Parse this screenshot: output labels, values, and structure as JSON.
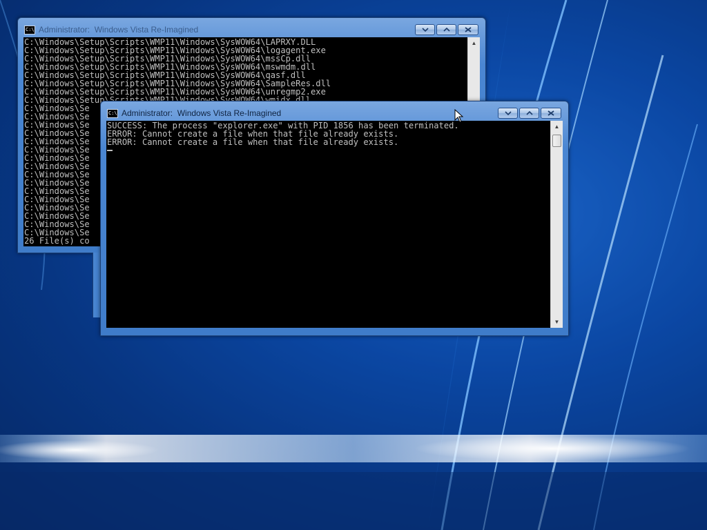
{
  "desktop": {
    "wallpaper": "windows-vista-aurora",
    "colors": {
      "base": "#0b4aa8",
      "glow": "#ffffff"
    }
  },
  "windows": {
    "back": {
      "title_prefix": "Administrator:",
      "title": "Windows Vista Re-Imagined",
      "lines": [
        "C:\\Windows\\Setup\\Scripts\\WMP11\\Windows\\SysWOW64\\LAPRXY.DLL",
        "C:\\Windows\\Setup\\Scripts\\WMP11\\Windows\\SysWOW64\\logagent.exe",
        "C:\\Windows\\Setup\\Scripts\\WMP11\\Windows\\SysWOW64\\mssCp.dll",
        "C:\\Windows\\Setup\\Scripts\\WMP11\\Windows\\SysWOW64\\mswmdm.dll",
        "C:\\Windows\\Setup\\Scripts\\WMP11\\Windows\\SysWOW64\\qasf.dll",
        "C:\\Windows\\Setup\\Scripts\\WMP11\\Windows\\SysWOW64\\SampleRes.dll",
        "C:\\Windows\\Setup\\Scripts\\WMP11\\Windows\\SysWOW64\\unregmp2.exe",
        "C:\\Windows\\Setup\\Scripts\\WMP11\\Windows\\SysWOW64\\wmidx.dll",
        "C:\\Windows\\Se",
        "C:\\Windows\\Se",
        "C:\\Windows\\Se",
        "C:\\Windows\\Se",
        "C:\\Windows\\Se",
        "C:\\Windows\\Se",
        "C:\\Windows\\Se",
        "C:\\Windows\\Se",
        "C:\\Windows\\Se",
        "C:\\Windows\\Se",
        "C:\\Windows\\Se",
        "C:\\Windows\\Se",
        "C:\\Windows\\Se",
        "C:\\Windows\\Se",
        "C:\\Windows\\Se",
        "C:\\Windows\\Se",
        "26 File(s) co"
      ]
    },
    "front": {
      "title_prefix": "Administrator:",
      "title": "Windows Vista Re-Imagined",
      "lines": [
        "SUCCESS: The process \"explorer.exe\" with PID 1856 has been terminated.",
        "ERROR: Cannot create a file when that file already exists.",
        "ERROR: Cannot create a file when that file already exists."
      ]
    }
  },
  "icons": {
    "window_icon": "cmd-icon",
    "minimize": "minimize-icon",
    "maximize": "maximize-icon",
    "close": "close-icon",
    "pointer": "mouse-pointer-icon"
  }
}
